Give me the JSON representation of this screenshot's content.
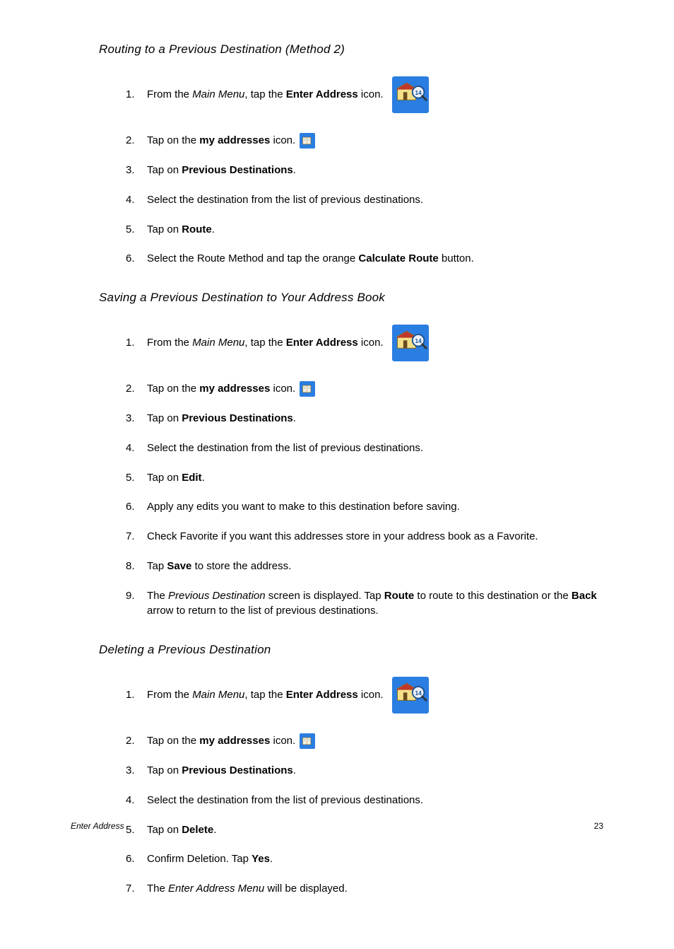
{
  "sections": [
    {
      "heading": "Routing to a Previous Destination (Method 2)",
      "steps": [
        {
          "num": "1.",
          "parts": [
            {
              "t": "From the "
            },
            {
              "t": "Main Menu",
              "style": "italic"
            },
            {
              "t": ", tap the "
            },
            {
              "t": "Enter Address",
              "style": "bold"
            },
            {
              "t": " icon."
            }
          ],
          "icon": "enter-address-icon",
          "iconSize": "big"
        },
        {
          "num": "2.",
          "parts": [
            {
              "t": "Tap on the "
            },
            {
              "t": "my addresses",
              "style": "bold"
            },
            {
              "t": " icon."
            }
          ],
          "icon": "my-addresses-icon",
          "iconSize": "small"
        },
        {
          "num": "3.",
          "parts": [
            {
              "t": "Tap on "
            },
            {
              "t": "Previous Destinations",
              "style": "bold"
            },
            {
              "t": "."
            }
          ]
        },
        {
          "num": "4.",
          "parts": [
            {
              "t": "Select the destination from the list of previous destinations."
            }
          ]
        },
        {
          "num": "5.",
          "parts": [
            {
              "t": "Tap on "
            },
            {
              "t": "Route",
              "style": "bold"
            },
            {
              "t": "."
            }
          ]
        },
        {
          "num": "6.",
          "parts": [
            {
              "t": "Select the Route Method and tap the orange "
            },
            {
              "t": "Calculate Route",
              "style": "bold"
            },
            {
              "t": " button."
            }
          ]
        }
      ]
    },
    {
      "heading": "Saving a Previous Destination to Your Address Book",
      "steps": [
        {
          "num": "1.",
          "parts": [
            {
              "t": "From the "
            },
            {
              "t": "Main Menu",
              "style": "italic"
            },
            {
              "t": ", tap the "
            },
            {
              "t": "Enter Address",
              "style": "bold"
            },
            {
              "t": " icon."
            }
          ],
          "icon": "enter-address-icon",
          "iconSize": "big"
        },
        {
          "num": "2.",
          "parts": [
            {
              "t": "Tap on the "
            },
            {
              "t": "my addresses",
              "style": "bold"
            },
            {
              "t": " icon."
            }
          ],
          "icon": "my-addresses-icon",
          "iconSize": "small"
        },
        {
          "num": "3.",
          "parts": [
            {
              "t": "Tap on "
            },
            {
              "t": "Previous Destinations",
              "style": "bold"
            },
            {
              "t": "."
            }
          ]
        },
        {
          "num": "4.",
          "parts": [
            {
              "t": "Select the destination from the list of previous destinations."
            }
          ]
        },
        {
          "num": "5.",
          "parts": [
            {
              "t": "Tap on "
            },
            {
              "t": "Edit",
              "style": "bold"
            },
            {
              "t": "."
            }
          ]
        },
        {
          "num": "6.",
          "parts": [
            {
              "t": "Apply any edits you want to make to this destination before saving."
            }
          ]
        },
        {
          "num": "7.",
          "parts": [
            {
              "t": "Check Favorite if you want this addresses store in your address book as a Favorite."
            }
          ]
        },
        {
          "num": "8.",
          "parts": [
            {
              "t": "Tap "
            },
            {
              "t": "Save",
              "style": "bold"
            },
            {
              "t": " to store the address."
            }
          ]
        },
        {
          "num": "9.",
          "parts": [
            {
              "t": "The "
            },
            {
              "t": "Previous Destination",
              "style": "italic"
            },
            {
              "t": " screen is displayed.  Tap "
            },
            {
              "t": "Route",
              "style": "bold"
            },
            {
              "t": " to route to this destination or the "
            },
            {
              "t": "Back",
              "style": "bold"
            },
            {
              "t": " arrow to return to the list of previous destinations."
            }
          ]
        }
      ]
    },
    {
      "heading": "Deleting a Previous Destination",
      "steps": [
        {
          "num": "1.",
          "parts": [
            {
              "t": "From the "
            },
            {
              "t": "Main Menu",
              "style": "italic"
            },
            {
              "t": ", tap the "
            },
            {
              "t": "Enter Address",
              "style": "bold"
            },
            {
              "t": " icon."
            }
          ],
          "icon": "enter-address-icon",
          "iconSize": "big"
        },
        {
          "num": "2.",
          "parts": [
            {
              "t": "Tap on the "
            },
            {
              "t": "my addresses",
              "style": "bold"
            },
            {
              "t": " icon."
            }
          ],
          "icon": "my-addresses-icon",
          "iconSize": "small"
        },
        {
          "num": "3.",
          "parts": [
            {
              "t": "Tap on "
            },
            {
              "t": "Previous Destinations",
              "style": "bold"
            },
            {
              "t": "."
            }
          ]
        },
        {
          "num": "4.",
          "parts": [
            {
              "t": "Select the destination from the list of previous destinations."
            }
          ]
        },
        {
          "num": "5.",
          "parts": [
            {
              "t": "Tap on "
            },
            {
              "t": "Delete",
              "style": "bold"
            },
            {
              "t": "."
            }
          ]
        },
        {
          "num": "6.",
          "parts": [
            {
              "t": "Confirm Deletion.  Tap "
            },
            {
              "t": "Yes",
              "style": "bold"
            },
            {
              "t": "."
            }
          ]
        },
        {
          "num": "7.",
          "parts": [
            {
              "t": "The "
            },
            {
              "t": "Enter Address Menu",
              "style": "italic"
            },
            {
              "t": " will be displayed."
            }
          ]
        }
      ]
    }
  ],
  "footer": {
    "left": "Enter Address",
    "right": "23"
  }
}
